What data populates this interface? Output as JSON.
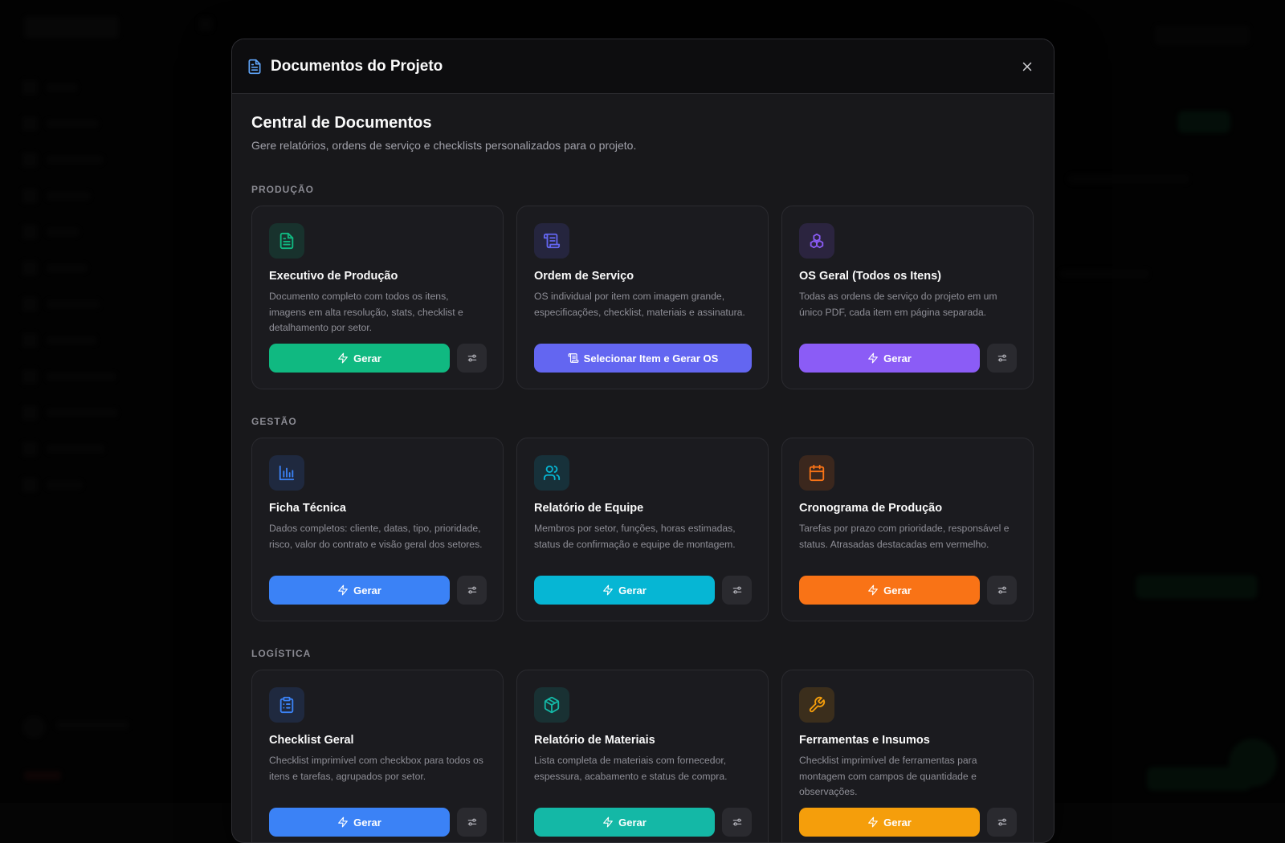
{
  "modal": {
    "title": "Documentos do Projeto",
    "heading": "Central de Documentos",
    "subheading": "Gere relatórios, ordens de serviço e checklists personalizados para o projeto."
  },
  "colors": {
    "green": "#10b981",
    "indigo": "#6366f1",
    "purple": "#8b5cf6",
    "blue": "#3b82f6",
    "cyan": "#06b6d4",
    "orange": "#f97316",
    "teal": "#14b8a6",
    "amber": "#f59e0b"
  },
  "sections": [
    {
      "label": "PRODUÇÃO",
      "cards": [
        {
          "icon": "file-text-icon",
          "title": "Executivo de Produção",
          "description": "Documento completo com todos os itens, imagens em alta resolução, stats, checklist e detalhamento por setor.",
          "button_label": "Gerar",
          "button_icon": "zap-icon",
          "has_config": true
        },
        {
          "icon": "scroll-icon",
          "title": "Ordem de Serviço",
          "description": "OS individual por item com imagem grande, especificações, checklist, materiais e assinatura.",
          "button_label": "Selecionar Item e Gerar OS",
          "button_icon": "scroll-icon",
          "has_config": false
        },
        {
          "icon": "boxes-icon",
          "title": "OS Geral (Todos os Itens)",
          "description": "Todas as ordens de serviço do projeto em um único PDF, cada item em página separada.",
          "button_label": "Gerar",
          "button_icon": "zap-icon",
          "has_config": true
        }
      ]
    },
    {
      "label": "GESTÃO",
      "cards": [
        {
          "icon": "bar-chart-icon",
          "title": "Ficha Técnica",
          "description": "Dados completos: cliente, datas, tipo, prioridade, risco, valor do contrato e visão geral dos setores.",
          "button_label": "Gerar",
          "button_icon": "zap-icon",
          "has_config": true
        },
        {
          "icon": "users-icon",
          "title": "Relatório de Equipe",
          "description": "Membros por setor, funções, horas estimadas, status de confirmação e equipe de montagem.",
          "button_label": "Gerar",
          "button_icon": "zap-icon",
          "has_config": true
        },
        {
          "icon": "calendar-icon",
          "title": "Cronograma de Produção",
          "description": "Tarefas por prazo com prioridade, responsável e status. Atrasadas destacadas em vermelho.",
          "button_label": "Gerar",
          "button_icon": "zap-icon",
          "has_config": true
        }
      ]
    },
    {
      "label": "LOGÍSTICA",
      "cards": [
        {
          "icon": "clipboard-list-icon",
          "title": "Checklist Geral",
          "description": "Checklist imprimível com checkbox para todos os itens e tarefas, agrupados por setor.",
          "button_label": "Gerar",
          "button_icon": "zap-icon",
          "has_config": true
        },
        {
          "icon": "package-icon",
          "title": "Relatório de Materiais",
          "description": "Lista completa de materiais com fornecedor, espessura, acabamento e status de compra.",
          "button_label": "Gerar",
          "button_icon": "zap-icon",
          "has_config": true
        },
        {
          "icon": "wrench-icon",
          "title": "Ferramentas e Insumos",
          "description": "Checklist imprimível de ferramentas para montagem com campos de quantidade e observações.",
          "button_label": "Gerar",
          "button_icon": "zap-icon",
          "has_config": true
        }
      ]
    }
  ]
}
